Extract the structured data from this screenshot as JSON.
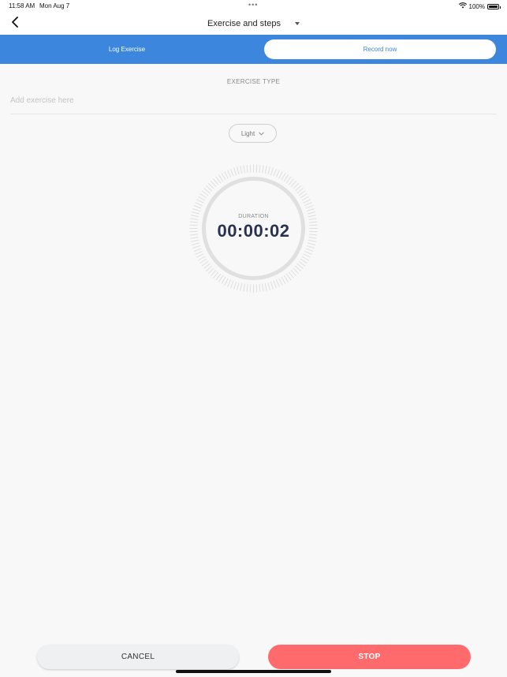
{
  "status_bar": {
    "time": "11:58 AM",
    "date": "Mon Aug 7",
    "battery": "100%",
    "icons": [
      "wifi-icon",
      "battery-icon"
    ]
  },
  "nav": {
    "title": "Exercise and steps",
    "back_icon": "chevron-left-icon",
    "dropdown_icon": "caret-down-icon"
  },
  "tabs": {
    "log_label": "Log Exercise",
    "record_label": "Record now",
    "active": "Record now"
  },
  "exercise": {
    "type_label": "EXERCISE TYPE",
    "placeholder": "Add exercise here",
    "value": ""
  },
  "intensity": {
    "selected": "Light",
    "icon": "chevron-down-icon"
  },
  "timer": {
    "label": "DURATION",
    "value": "00:00:02"
  },
  "actions": {
    "cancel_label": "CANCEL",
    "stop_label": "STOP"
  },
  "colors": {
    "accent": "#3c86dd",
    "stop": "#ff6b6d",
    "timer_text": "#2a3250",
    "background": "#f8f8f8"
  }
}
